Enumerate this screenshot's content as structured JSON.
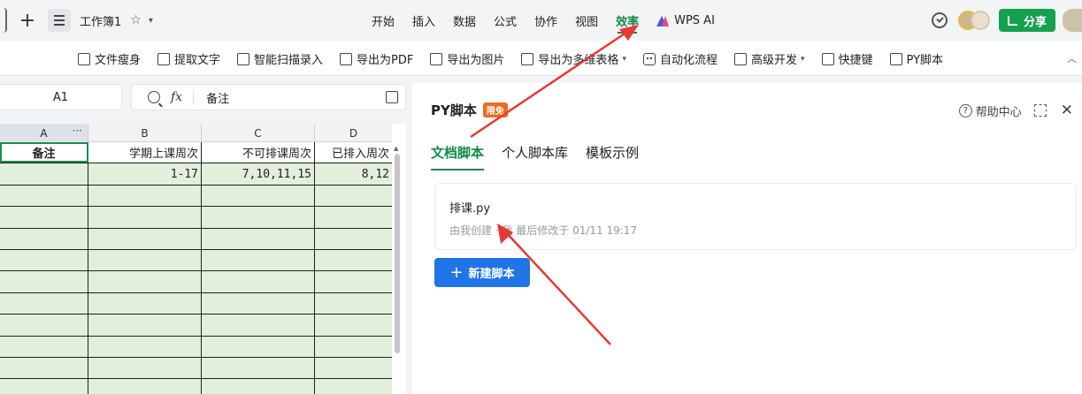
{
  "topbar": {
    "doc_title": "工作簿1",
    "menu": [
      "开始",
      "插入",
      "数据",
      "公式",
      "协作",
      "视图",
      "效率"
    ],
    "wps_ai": "WPS AI",
    "share": "分享"
  },
  "toolbar": {
    "items": [
      "文件瘦身",
      "提取文字",
      "智能扫描录入",
      "导出为PDF",
      "导出为图片",
      "导出为多维表格",
      "自动化流程",
      "高级开发",
      "快捷键",
      "PY脚本"
    ]
  },
  "sheet": {
    "cell_ref": "A1",
    "formula_value": "备注",
    "columns": [
      "A",
      "B",
      "C",
      "D"
    ],
    "header_cells": [
      "备注",
      "学期上课周次",
      "不可排课周次",
      "已排入周次"
    ],
    "row1": [
      "",
      "1-17",
      "7,10,11,15",
      "8,12"
    ]
  },
  "panel": {
    "title": "PY脚本",
    "badge": "限免",
    "help": "帮助中心",
    "tabs": [
      "文档脚本",
      "个人脚本库",
      "模板示例"
    ],
    "script_name": "排课.py",
    "script_meta": "由我创建 · 我 最后修改于 01/11 19:17",
    "new_script": "新建脚本"
  },
  "colors": {
    "accent_green": "#118a47",
    "share_green": "#14a14f",
    "primary_blue": "#1f75e6",
    "cell_green": "#e2efda",
    "badge_orange": "#ee6c1b",
    "annotation_red": "#e53935"
  }
}
